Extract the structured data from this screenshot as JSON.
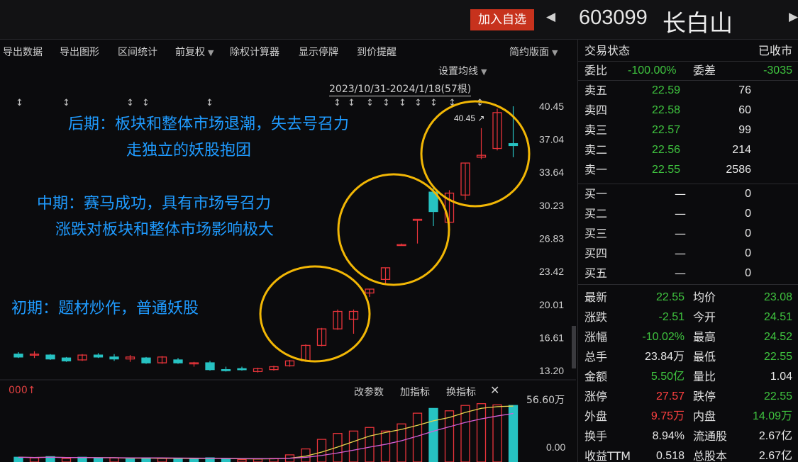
{
  "header": {
    "add_watchlist": "加入自选",
    "prev_arrow": "◀",
    "next_arrow": "▶",
    "stock_code": "603099",
    "stock_name": "长白山"
  },
  "toolbar": {
    "items": [
      "导出数据",
      "导出图形",
      "区间统计",
      "前复权",
      "除权计算器",
      "显示停牌",
      "到价提醒",
      "简约版面"
    ],
    "ma_setting": "设置均线",
    "date_range": "2023/10/31-2024/1/18(57根)"
  },
  "annotations": {
    "late_line1": "后期：板块和整体市场退潮，失去号召力",
    "late_line2": "走独立的妖股抱团",
    "mid_line1": "中期：赛马成功，具有市场号召力",
    "mid_line2": "涨跌对板块和整体市场影响极大",
    "early_line1": "初期：题材炒作，普通妖股"
  },
  "chart_data": {
    "type": "candlestick",
    "y_ticks": [
      "40.45",
      "37.04",
      "33.64",
      "30.23",
      "26.83",
      "23.42",
      "20.01",
      "16.61",
      "13.20"
    ],
    "ylim": [
      13.2,
      40.45
    ],
    "high_label": "40.45",
    "candles": [
      {
        "o": 14.9,
        "h": 15.1,
        "l": 14.5,
        "c": 14.6
      },
      {
        "o": 14.8,
        "h": 15.2,
        "l": 14.5,
        "c": 14.9
      },
      {
        "o": 14.8,
        "h": 14.9,
        "l": 14.3,
        "c": 14.4
      },
      {
        "o": 14.5,
        "h": 14.6,
        "l": 14.1,
        "c": 14.2
      },
      {
        "o": 14.3,
        "h": 14.9,
        "l": 14.2,
        "c": 14.8
      },
      {
        "o": 14.8,
        "h": 15.0,
        "l": 14.5,
        "c": 14.6
      },
      {
        "o": 14.6,
        "h": 14.9,
        "l": 14.2,
        "c": 14.4
      },
      {
        "o": 14.4,
        "h": 14.8,
        "l": 14.1,
        "c": 14.6
      },
      {
        "o": 14.5,
        "h": 14.6,
        "l": 13.9,
        "c": 14.0
      },
      {
        "o": 14.0,
        "h": 14.7,
        "l": 13.9,
        "c": 14.6
      },
      {
        "o": 14.3,
        "h": 14.5,
        "l": 13.9,
        "c": 14.0
      },
      {
        "o": 13.9,
        "h": 14.1,
        "l": 13.6,
        "c": 14.0
      },
      {
        "o": 14.0,
        "h": 14.2,
        "l": 13.2,
        "c": 13.3
      },
      {
        "o": 13.3,
        "h": 13.6,
        "l": 13.1,
        "c": 13.2
      },
      {
        "o": 13.4,
        "h": 13.6,
        "l": 13.2,
        "c": 13.3
      },
      {
        "o": 13.1,
        "h": 13.5,
        "l": 13.0,
        "c": 13.4
      },
      {
        "o": 13.3,
        "h": 13.7,
        "l": 13.2,
        "c": 13.6
      },
      {
        "o": 13.7,
        "h": 14.3,
        "l": 13.6,
        "c": 14.2
      },
      {
        "o": 14.2,
        "h": 15.9,
        "l": 14.1,
        "c": 15.8
      },
      {
        "o": 15.8,
        "h": 17.6,
        "l": 15.7,
        "c": 17.5
      },
      {
        "o": 17.5,
        "h": 19.5,
        "l": 17.4,
        "c": 19.3
      },
      {
        "o": 18.5,
        "h": 19.5,
        "l": 17.0,
        "c": 19.3
      },
      {
        "o": 21.2,
        "h": 21.6,
        "l": 20.8,
        "c": 21.6
      },
      {
        "o": 22.6,
        "h": 23.8,
        "l": 22.0,
        "c": 23.8
      },
      {
        "o": 26.2,
        "h": 26.3,
        "l": 26.1,
        "c": 26.2
      },
      {
        "o": 28.8,
        "h": 28.8,
        "l": 26.3,
        "c": 28.8
      },
      {
        "o": 31.6,
        "h": 32.3,
        "l": 28.1,
        "c": 29.6
      },
      {
        "o": 28.5,
        "h": 31.8,
        "l": 27.6,
        "c": 31.5
      },
      {
        "o": 31.3,
        "h": 34.6,
        "l": 30.8,
        "c": 34.6
      },
      {
        "o": 35.2,
        "h": 38.2,
        "l": 35.0,
        "c": 35.4
      },
      {
        "o": 36.1,
        "h": 40.2,
        "l": 35.9,
        "c": 39.8
      },
      {
        "o": 36.6,
        "h": 40.45,
        "l": 35.2,
        "c": 36.4
      }
    ],
    "volume_max_label": "56.60万",
    "volume_min_label": "0.00",
    "volumes": [
      {
        "v": 0.08,
        "up": false
      },
      {
        "v": 0.07,
        "up": true
      },
      {
        "v": 0.09,
        "up": false
      },
      {
        "v": 0.06,
        "up": true
      },
      {
        "v": 0.08,
        "up": false
      },
      {
        "v": 0.06,
        "up": false
      },
      {
        "v": 0.07,
        "up": true
      },
      {
        "v": 0.05,
        "up": false
      },
      {
        "v": 0.07,
        "up": false
      },
      {
        "v": 0.06,
        "up": true
      },
      {
        "v": 0.06,
        "up": false
      },
      {
        "v": 0.05,
        "up": false
      },
      {
        "v": 0.07,
        "up": false
      },
      {
        "v": 0.05,
        "up": false
      },
      {
        "v": 0.04,
        "up": true
      },
      {
        "v": 0.05,
        "up": true
      },
      {
        "v": 0.06,
        "up": true
      },
      {
        "v": 0.12,
        "up": true
      },
      {
        "v": 0.22,
        "up": true
      },
      {
        "v": 0.38,
        "up": true
      },
      {
        "v": 0.48,
        "up": true
      },
      {
        "v": 0.52,
        "up": true
      },
      {
        "v": 0.58,
        "up": true
      },
      {
        "v": 0.52,
        "up": true
      },
      {
        "v": 0.64,
        "up": true
      },
      {
        "v": 0.82,
        "up": true
      },
      {
        "v": 0.9,
        "up": false
      },
      {
        "v": 0.86,
        "up": true
      },
      {
        "v": 0.95,
        "up": true
      },
      {
        "v": 0.98,
        "up": true
      },
      {
        "v": 0.96,
        "up": true
      },
      {
        "v": 0.95,
        "up": false
      }
    ]
  },
  "sub_panel": {
    "indicator": "000↑",
    "btn_params": "改参数",
    "btn_add": "加指标",
    "btn_switch": "换指标",
    "btn_close": "✕"
  },
  "quote": {
    "status_label": "交易状态",
    "status_value": "已收市",
    "ratio_label": "委比",
    "ratio_value": "-100.00%",
    "diff_label": "委差",
    "diff_value": "-3035",
    "sells": [
      {
        "label": "卖五",
        "price": "22.59",
        "vol": "76"
      },
      {
        "label": "卖四",
        "price": "22.58",
        "vol": "60"
      },
      {
        "label": "卖三",
        "price": "22.57",
        "vol": "99"
      },
      {
        "label": "卖二",
        "price": "22.56",
        "vol": "214"
      },
      {
        "label": "卖一",
        "price": "22.55",
        "vol": "2586"
      }
    ],
    "buys": [
      {
        "label": "买一",
        "price": "—",
        "vol": "0"
      },
      {
        "label": "买二",
        "price": "—",
        "vol": "0"
      },
      {
        "label": "买三",
        "price": "—",
        "vol": "0"
      },
      {
        "label": "买四",
        "price": "—",
        "vol": "0"
      },
      {
        "label": "买五",
        "price": "—",
        "vol": "0"
      }
    ],
    "stats": [
      {
        "l1": "最新",
        "v1": "22.55",
        "c1": "grn",
        "l2": "均价",
        "v2": "23.08",
        "c2": "grn"
      },
      {
        "l1": "涨跌",
        "v1": "-2.51",
        "c1": "grn",
        "l2": "今开",
        "v2": "24.51",
        "c2": "grn"
      },
      {
        "l1": "涨幅",
        "v1": "-10.02%",
        "c1": "grn",
        "l2": "最高",
        "v2": "24.52",
        "c2": "grn"
      },
      {
        "l1": "总手",
        "v1": "23.84万",
        "c1": "wht",
        "l2": "最低",
        "v2": "22.55",
        "c2": "grn"
      },
      {
        "l1": "金额",
        "v1": "5.50亿",
        "c1": "grn",
        "l2": "量比",
        "v2": "1.04",
        "c2": "wht"
      },
      {
        "l1": "涨停",
        "v1": "27.57",
        "c1": "red",
        "l2": "跌停",
        "v2": "22.55",
        "c2": "grn"
      },
      {
        "l1": "外盘",
        "v1": "9.75万",
        "c1": "red",
        "l2": "内盘",
        "v2": "14.09万",
        "c2": "grn"
      },
      {
        "l1": "换手",
        "v1": "8.94%",
        "c1": "wht",
        "l2": "流通股",
        "v2": "2.67亿",
        "c2": "wht"
      },
      {
        "l1": "收益TTM",
        "v1": "0.518",
        "c1": "wht",
        "l2": "总股本",
        "v2": "2.67亿",
        "c2": "wht"
      }
    ]
  },
  "colors": {
    "up": "#e8343a",
    "down": "#27c2c2",
    "circle": "#f2b705",
    "annotation": "#1f9bff",
    "brand_button": "#c7321d"
  }
}
